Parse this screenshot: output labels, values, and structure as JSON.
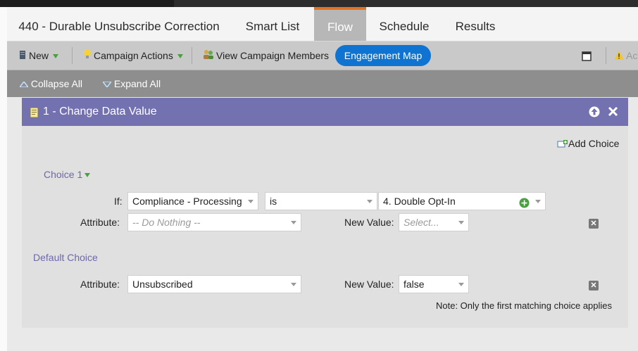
{
  "tabs": [
    {
      "label": "440 - Durable Unsubscribe Correction"
    },
    {
      "label": "Smart List"
    },
    {
      "label": "Flow"
    },
    {
      "label": "Schedule"
    },
    {
      "label": "Results"
    }
  ],
  "toolbar": {
    "new_label": "New",
    "campaign_actions_label": "Campaign Actions",
    "view_members_label": "View Campaign Members",
    "engagement_map_label": "Engagement Map",
    "right_action_label": "Act"
  },
  "subtoolbar": {
    "collapse_all": "Collapse All",
    "expand_all": "Expand All"
  },
  "flow_step": {
    "title": "1 - Change Data Value",
    "add_choice": "Add Choice",
    "choice1": {
      "label": "Choice 1",
      "if_label": "If:",
      "field_value": "Compliance - Processing",
      "operator_value": "is",
      "match_value": "4. Double Opt-In",
      "attribute_label": "Attribute:",
      "attribute_placeholder": "-- Do Nothing --",
      "new_value_label": "New Value:",
      "new_value_placeholder": "Select..."
    },
    "default_choice": {
      "label": "Default Choice",
      "attribute_label": "Attribute:",
      "attribute_value": "Unsubscribed",
      "new_value_label": "New Value:",
      "new_value_value": "false"
    },
    "note": "Note: Only the first matching choice applies"
  },
  "colors": {
    "accent_orange": "#e37222",
    "header_purple": "#7371b0",
    "button_blue": "#0f74d1"
  }
}
